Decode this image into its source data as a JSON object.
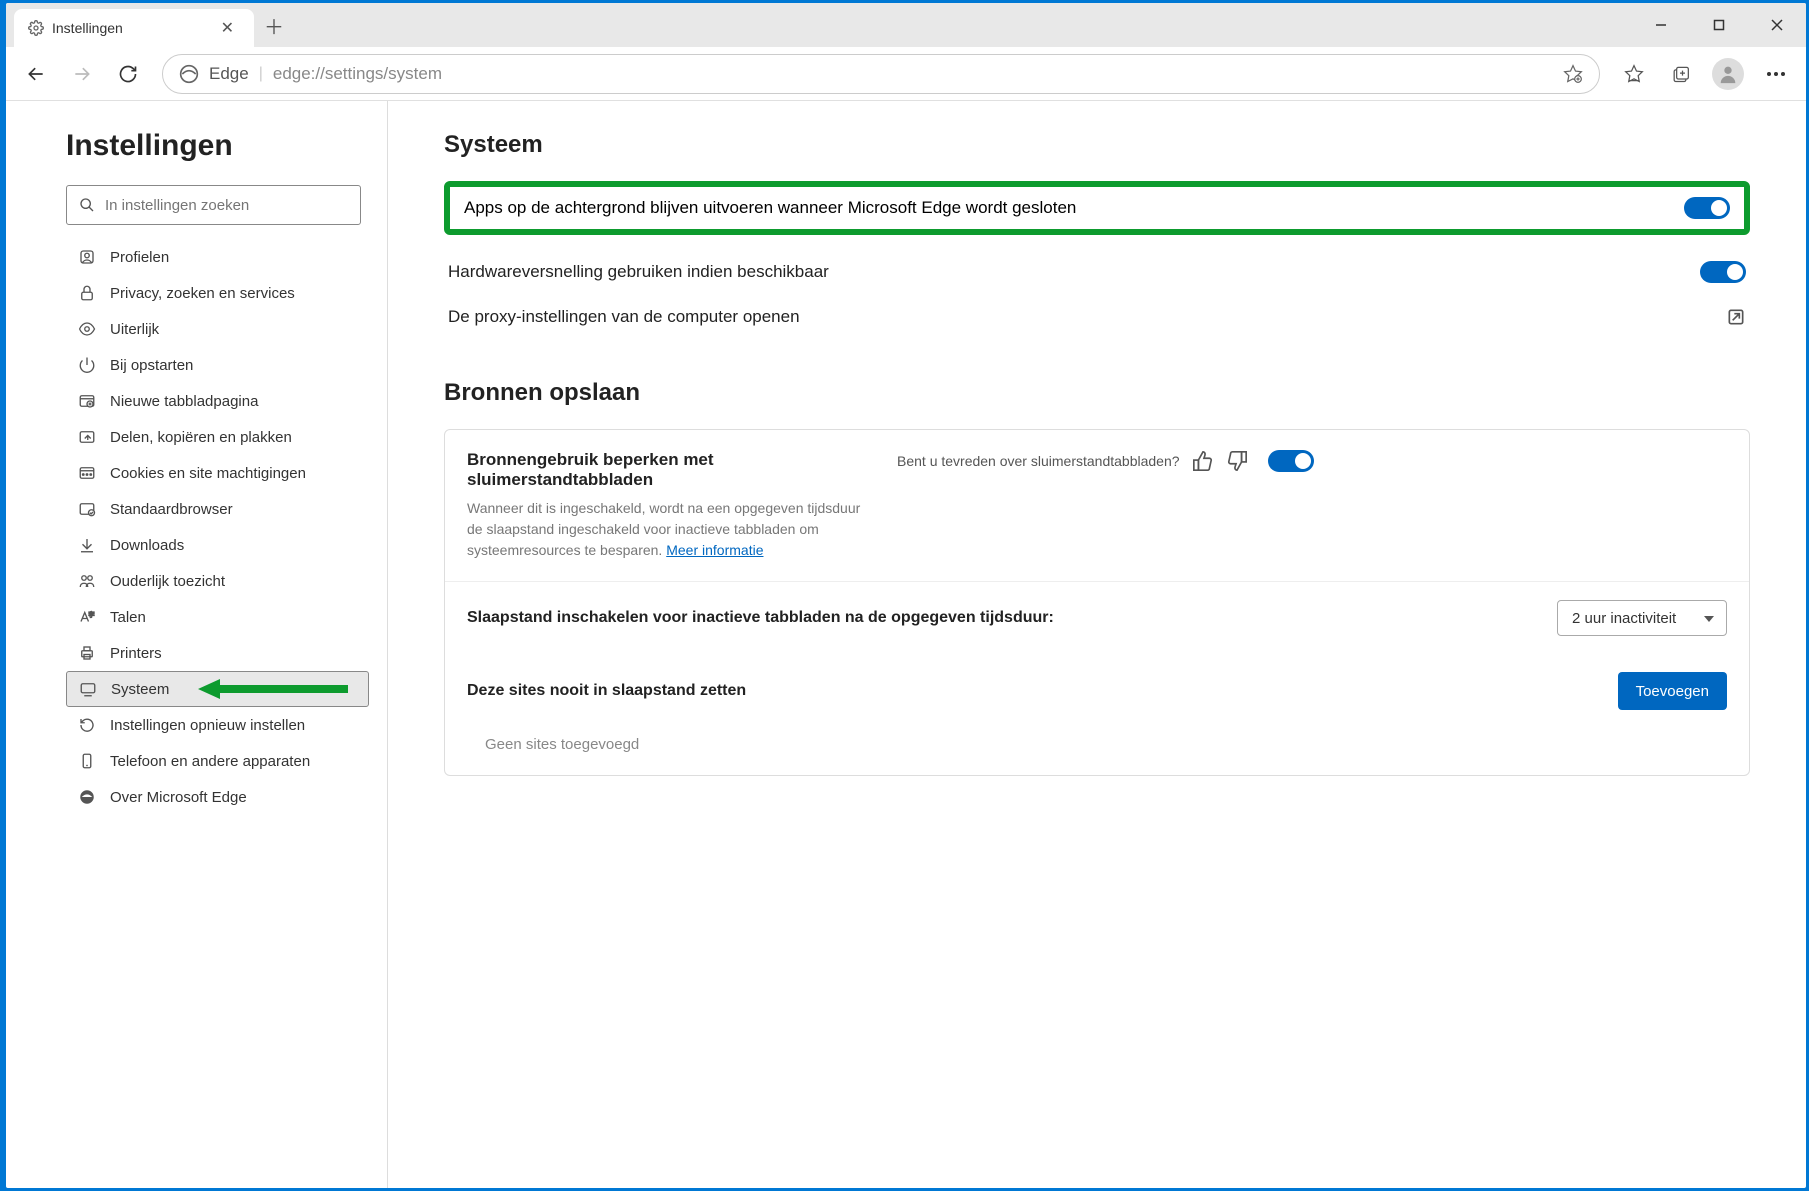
{
  "tab": {
    "title": "Instellingen"
  },
  "address": {
    "label": "Edge",
    "url": "edge://settings/system"
  },
  "sidebar": {
    "title": "Instellingen",
    "search_placeholder": "In instellingen zoeken",
    "items": [
      {
        "label": "Profielen"
      },
      {
        "label": "Privacy, zoeken en services"
      },
      {
        "label": "Uiterlijk"
      },
      {
        "label": "Bij opstarten"
      },
      {
        "label": "Nieuwe tabbladpagina"
      },
      {
        "label": "Delen, kopiëren en plakken"
      },
      {
        "label": "Cookies en site machtigingen"
      },
      {
        "label": "Standaardbrowser"
      },
      {
        "label": "Downloads"
      },
      {
        "label": "Ouderlijk toezicht"
      },
      {
        "label": "Talen"
      },
      {
        "label": "Printers"
      },
      {
        "label": "Systeem"
      },
      {
        "label": "Instellingen opnieuw instellen"
      },
      {
        "label": "Telefoon en andere apparaten"
      },
      {
        "label": "Over Microsoft Edge"
      }
    ]
  },
  "main": {
    "heading": "Systeem",
    "rows": [
      {
        "label": "Apps op de achtergrond blijven uitvoeren wanneer Microsoft Edge wordt gesloten"
      },
      {
        "label": "Hardwareversnelling gebruiken indien beschikbaar"
      },
      {
        "label": "De proxy-instellingen van de computer openen"
      }
    ],
    "section2": "Bronnen opslaan",
    "card": {
      "title": "Bronnengebruik beperken met sluimerstandtabbladen",
      "desc": "Wanneer dit is ingeschakeld, wordt na een opgegeven tijdsduur de slaapstand ingeschakeld voor inactieve tabbladen om systeemresources te besparen. ",
      "more": "Meer informatie",
      "feedback_q": "Bent u tevreden over sluimerstandtabbladen?",
      "row1_label": "Slaapstand inschakelen voor inactieve tabbladen na de opgegeven tijdsduur:",
      "select_value": "2 uur inactiviteit",
      "row2_label": "Deze sites nooit in slaapstand zetten",
      "add_button": "Toevoegen",
      "empty": "Geen sites toegevoegd"
    }
  },
  "annotations": {
    "highlight_color": "#0d9b2e"
  }
}
